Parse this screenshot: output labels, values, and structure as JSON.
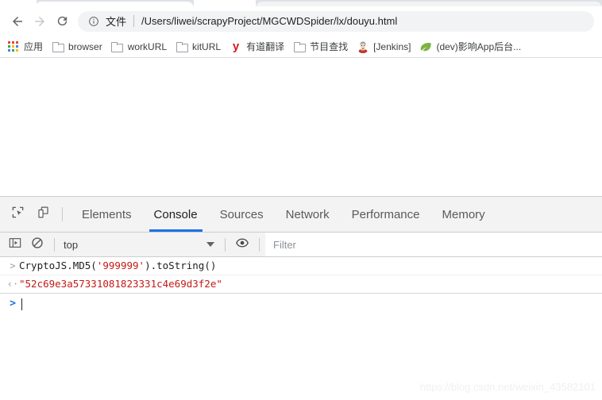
{
  "browser": {
    "nav": {
      "back_label": "Back",
      "forward_label": "Forward",
      "reload_label": "Reload"
    },
    "omnibox": {
      "info_icon": "info-circle-icon",
      "scheme_label": "文件",
      "url": "/Users/liwei/scrapyProject/MGCWDSpider/lx/douyu.html"
    },
    "bookmarks": [
      {
        "label": "应用",
        "icon": "apps-grid-icon"
      },
      {
        "label": "browser",
        "icon": "folder-icon"
      },
      {
        "label": "workURL",
        "icon": "folder-icon"
      },
      {
        "label": "kitURL",
        "icon": "folder-icon"
      },
      {
        "label": "有道翻译",
        "icon": "youdao-icon"
      },
      {
        "label": "节目查找",
        "icon": "folder-icon"
      },
      {
        "label": "[Jenkins]",
        "icon": "jenkins-icon"
      },
      {
        "label": "(dev)影响App后台...",
        "icon": "leaf-icon"
      }
    ]
  },
  "devtools": {
    "inspect_icon": "inspect-element-icon",
    "device_icon": "device-toolbar-icon",
    "tabs": [
      {
        "label": "Elements",
        "active": false
      },
      {
        "label": "Console",
        "active": true
      },
      {
        "label": "Sources",
        "active": false
      },
      {
        "label": "Network",
        "active": false
      },
      {
        "label": "Performance",
        "active": false
      },
      {
        "label": "Memory",
        "active": false
      }
    ],
    "console_toolbar": {
      "sidebar_icon": "console-sidebar-icon",
      "clear_icon": "clear-console-icon",
      "context_value": "top",
      "context_caret_icon": "chevron-down-icon",
      "eye_icon": "live-expression-eye-icon",
      "filter_placeholder": "Filter",
      "filter_value": ""
    },
    "console_messages": [
      {
        "gutter": ">",
        "gutter_type": "input",
        "parts": [
          {
            "text": "CryptoJS.MD5(",
            "type": "plain"
          },
          {
            "text": "'999999'",
            "type": "string"
          },
          {
            "text": ").toString()",
            "type": "plain"
          }
        ]
      },
      {
        "gutter": "‹·",
        "gutter_type": "result",
        "parts": [
          {
            "text": "\"52c69e3a57331081823331c4e69d3f2e\"",
            "type": "result"
          }
        ]
      }
    ],
    "prompt": {
      "caret": ">",
      "value": ""
    }
  },
  "watermark": "https://blog.csdn.net/weixin_43582101",
  "colors": {
    "accent_blue": "#1a73e8",
    "string_red": "#c41a16",
    "toolbar_grey": "#f3f3f3",
    "omnibox_grey": "#f1f3f4"
  }
}
